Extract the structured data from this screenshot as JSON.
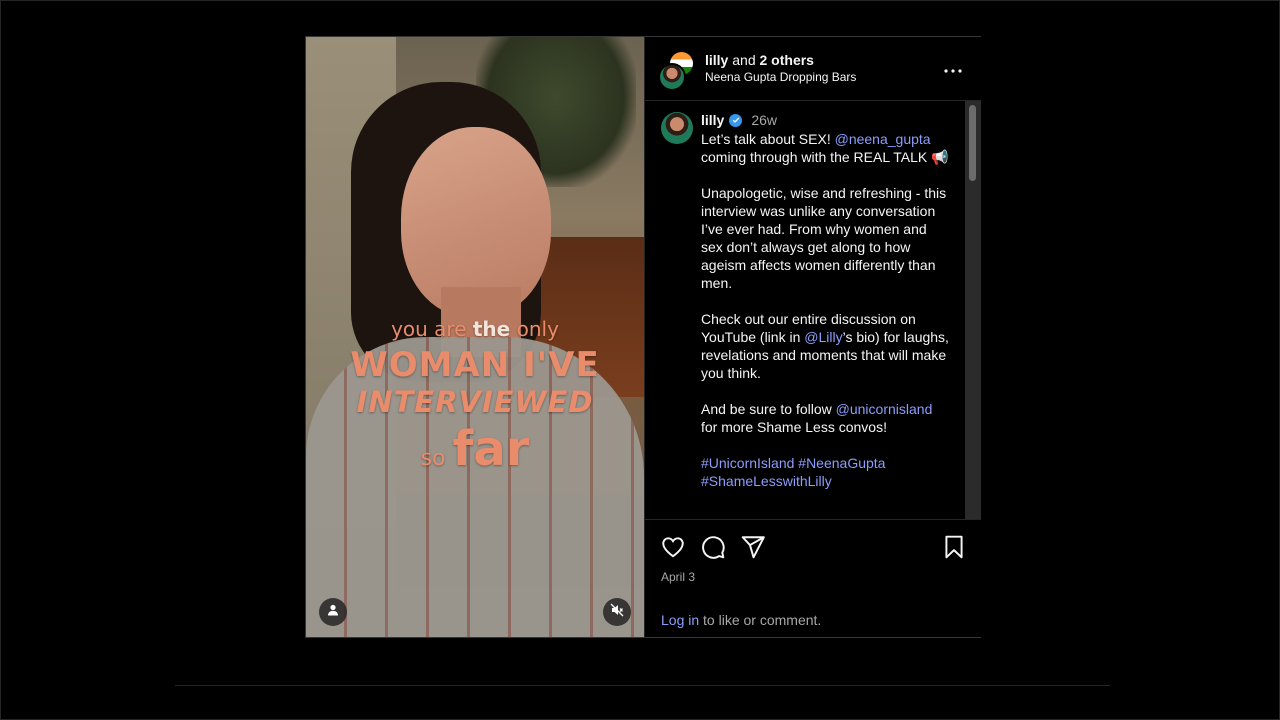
{
  "media": {
    "overlay_line1_a": "you are",
    "overlay_line1_b": "the",
    "overlay_line1_c": "only",
    "overlay_line2": "WOMAN I'VE",
    "overlay_line3": "INTERVIEWED",
    "overlay_line4_a": "so",
    "overlay_line4_b": "far"
  },
  "header": {
    "author": "lilly",
    "and_text": "and",
    "others": "2 others",
    "subtitle": "Neena Gupta Dropping Bars"
  },
  "caption": {
    "username": "lilly",
    "time": "26w",
    "p1_a": "Let’s talk about SEX! ",
    "p1_mention": "@neena_gupta",
    "p1_b": " coming through with the REAL TALK 📢",
    "p2": "Unapologetic, wise and refreshing - this interview was unlike any conversation I’ve ever had. From why women and sex don’t always get along to how ageism affects women differently than men.",
    "p3_a": "Check out our entire discussion on YouTube (link in ",
    "p3_mention": "@Lilly",
    "p3_b": "’s bio) for laughs, revelations and moments that will make you think.",
    "p4_a": "And be sure to follow ",
    "p4_mention": "@unicornisland",
    "p4_b": " for more Shame Less convos!",
    "hashtag1": "#UnicornIsland",
    "hashtag2": "#NeenaGupta",
    "hashtag3": "#ShameLesswithLilly"
  },
  "footer": {
    "date": "April 3",
    "login_link": "Log in",
    "login_rest": " to like or comment."
  },
  "icons": [
    "user-tag-icon",
    "mute-icon",
    "more-icon",
    "verified-icon",
    "heart-icon",
    "comment-icon",
    "share-icon",
    "bookmark-icon"
  ],
  "colors": {
    "link": "#8c9dfc",
    "muted": "#a8a8a8",
    "verified": "#3897f0",
    "background": "#000000"
  }
}
